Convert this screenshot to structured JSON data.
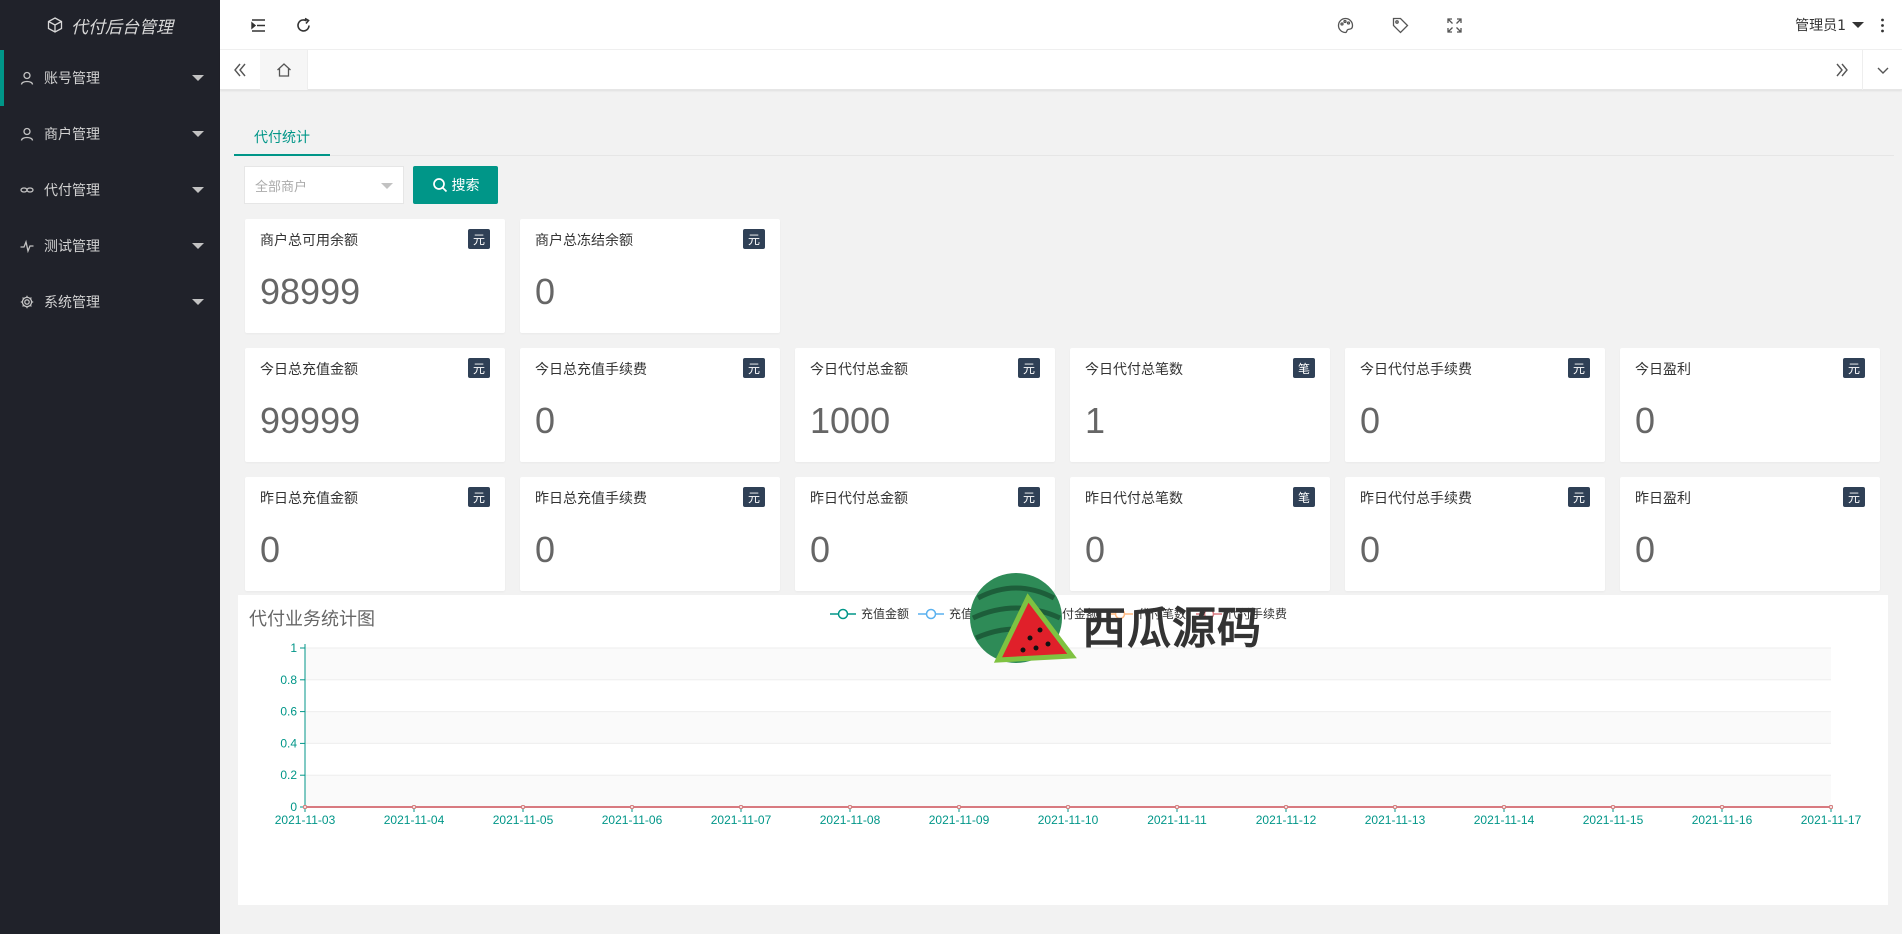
{
  "app": {
    "title": "代付后台管理"
  },
  "sidebar": {
    "items": [
      {
        "label": "账号管理",
        "icon": "user-icon"
      },
      {
        "label": "商户管理",
        "icon": "user-icon"
      },
      {
        "label": "代付管理",
        "icon": "link-icon"
      },
      {
        "label": "测试管理",
        "icon": "pulse-icon"
      },
      {
        "label": "系统管理",
        "icon": "gear-icon"
      }
    ]
  },
  "header": {
    "user_label": "管理员1"
  },
  "page_tab": {
    "label": "代付统计"
  },
  "filter": {
    "placeholder": "全部商户",
    "search_label": "搜索"
  },
  "cards_row1": [
    {
      "title": "商户总可用余额",
      "unit": "元",
      "value": "98999"
    },
    {
      "title": "商户总冻结余额",
      "unit": "元",
      "value": "0"
    }
  ],
  "cards_row2": [
    {
      "title": "今日总充值金额",
      "unit": "元",
      "value": "99999"
    },
    {
      "title": "今日总充值手续费",
      "unit": "元",
      "value": "0"
    },
    {
      "title": "今日代付总金额",
      "unit": "元",
      "value": "1000"
    },
    {
      "title": "今日代付总笔数",
      "unit": "笔",
      "value": "1"
    },
    {
      "title": "今日代付总手续费",
      "unit": "元",
      "value": "0"
    },
    {
      "title": "今日盈利",
      "unit": "元",
      "value": "0"
    }
  ],
  "cards_row3": [
    {
      "title": "昨日总充值金额",
      "unit": "元",
      "value": "0"
    },
    {
      "title": "昨日总充值手续费",
      "unit": "元",
      "value": "0"
    },
    {
      "title": "昨日代付总金额",
      "unit": "元",
      "value": "0"
    },
    {
      "title": "昨日代付总笔数",
      "unit": "笔",
      "value": "0"
    },
    {
      "title": "昨日代付总手续费",
      "unit": "元",
      "value": "0"
    },
    {
      "title": "昨日盈利",
      "unit": "元",
      "value": "0"
    }
  ],
  "watermark": {
    "text": "西瓜源码"
  },
  "chart_data": {
    "type": "line",
    "title": "代付业务统计图",
    "x": [
      "2021-11-03",
      "2021-11-04",
      "2021-11-05",
      "2021-11-06",
      "2021-11-07",
      "2021-11-08",
      "2021-11-09",
      "2021-11-10",
      "2021-11-11",
      "2021-11-12",
      "2021-11-13",
      "2021-11-14",
      "2021-11-15",
      "2021-11-16",
      "2021-11-17"
    ],
    "ylim": [
      0,
      1
    ],
    "yticks": [
      "0",
      "0.2",
      "0.4",
      "0.6",
      "0.8",
      "1"
    ],
    "series": [
      {
        "name": "充值金额",
        "color": "#009688",
        "values": [
          0,
          0,
          0,
          0,
          0,
          0,
          0,
          0,
          0,
          0,
          0,
          0,
          0,
          0,
          0
        ]
      },
      {
        "name": "充值手续费",
        "color": "#5ab1ef",
        "values": [
          0,
          0,
          0,
          0,
          0,
          0,
          0,
          0,
          0,
          0,
          0,
          0,
          0,
          0,
          0
        ]
      },
      {
        "name": "代付金额",
        "color": "#8bc34a",
        "values": [
          0,
          0,
          0,
          0,
          0,
          0,
          0,
          0,
          0,
          0,
          0,
          0,
          0,
          0,
          0
        ]
      },
      {
        "name": "代付笔数",
        "color": "#ffb980",
        "values": [
          0,
          0,
          0,
          0,
          0,
          0,
          0,
          0,
          0,
          0,
          0,
          0,
          0,
          0,
          0
        ]
      },
      {
        "name": "代付手续费",
        "color": "#d87a80",
        "values": [
          0,
          0,
          0,
          0,
          0,
          0,
          0,
          0,
          0,
          0,
          0,
          0,
          0,
          0,
          0
        ]
      }
    ],
    "grid": true,
    "legend_position": "top-center"
  }
}
